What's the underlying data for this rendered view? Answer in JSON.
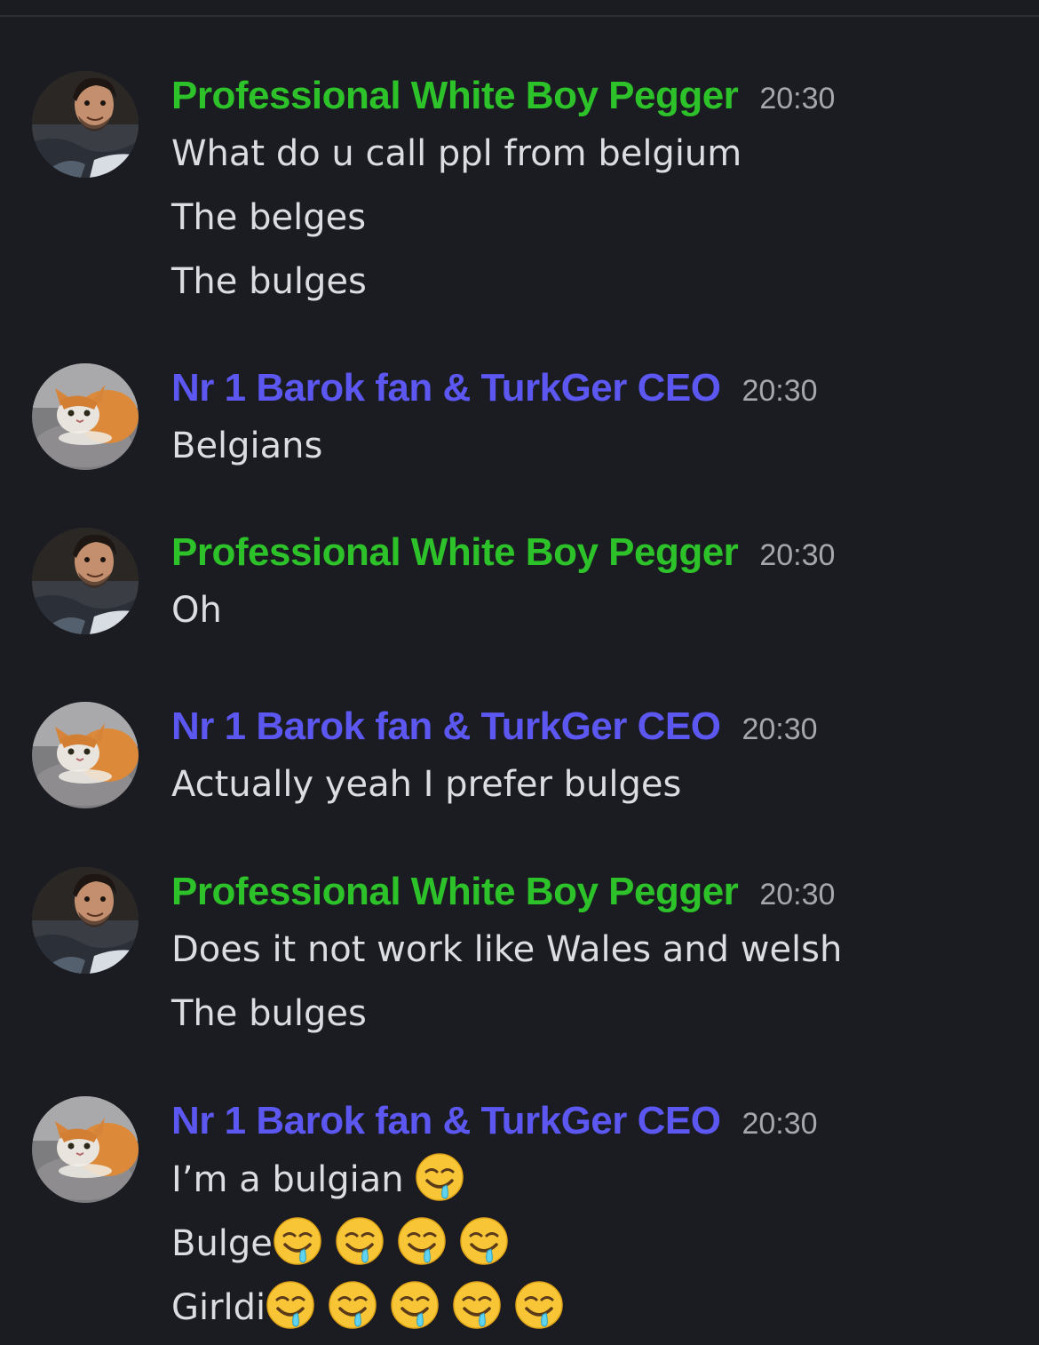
{
  "messages": [
    {
      "author": "Professional White Boy Pegger",
      "author_color": "#2dc12a",
      "avatar": "man-avatar",
      "time": "20:30",
      "lines": [
        {
          "text": "What do u call ppl from belgium",
          "emoji_count": 0
        },
        {
          "text": "The belges",
          "emoji_count": 0
        },
        {
          "text": "The bulges",
          "emoji_count": 0
        }
      ]
    },
    {
      "author": "Nr 1 Barok fan & TurkGer CEO",
      "author_color": "#5b57f0",
      "avatar": "cat-avatar",
      "time": "20:30",
      "lines": [
        {
          "text": "Belgians",
          "emoji_count": 0
        }
      ]
    },
    {
      "author": "Professional White Boy Pegger",
      "author_color": "#2dc12a",
      "avatar": "man-avatar",
      "time": "20:30",
      "lines": [
        {
          "text": "Oh",
          "emoji_count": 0
        }
      ]
    },
    {
      "author": "Nr 1 Barok fan & TurkGer CEO",
      "author_color": "#5b57f0",
      "avatar": "cat-avatar",
      "time": "20:30",
      "lines": [
        {
          "text": "Actually yeah I prefer bulges",
          "emoji_count": 0
        }
      ]
    },
    {
      "author": "Professional White Boy Pegger",
      "author_color": "#2dc12a",
      "avatar": "man-avatar",
      "time": "20:30",
      "lines": [
        {
          "text": "Does it not work like Wales and welsh",
          "emoji_count": 0
        },
        {
          "text": "The bulges",
          "emoji_count": 0
        }
      ]
    },
    {
      "author": "Nr 1 Barok fan & TurkGer CEO",
      "author_color": "#5b57f0",
      "avatar": "cat-avatar",
      "time": "20:30",
      "lines": [
        {
          "text": "I’m a bulgian ",
          "emoji_count": 1,
          "emoji": "drooling-face-icon"
        },
        {
          "text": "Bulge",
          "emoji_count": 4,
          "emoji": "drooling-face-icon"
        },
        {
          "text": "Girldi",
          "emoji_count": 5,
          "emoji": "drooling-face-icon"
        }
      ]
    }
  ]
}
